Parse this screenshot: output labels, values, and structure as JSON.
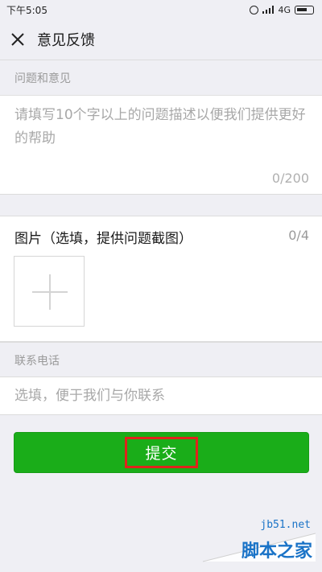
{
  "status_bar": {
    "time": "下午5:05",
    "network": "4G",
    "icons": [
      "alarm-icon",
      "signal-icon",
      "battery-icon"
    ]
  },
  "header": {
    "close_icon": "close-icon",
    "title": "意见反馈"
  },
  "feedback": {
    "section_label": "问题和意见",
    "placeholder": "请填写10个字以上的问题描述以便我们提供更好的帮助",
    "char_count": "0/200"
  },
  "images": {
    "title": "图片（选填，提供问题截图）",
    "count": "0/4",
    "add_icon": "plus-icon"
  },
  "contact": {
    "section_label": "联系电话",
    "placeholder": "选填，便于我们与你联系"
  },
  "submit": {
    "label": "提交"
  },
  "colors": {
    "background": "#efeff4",
    "primary_green": "#1aad19",
    "highlight_red": "#e0231c",
    "watermark_blue": "#1a73c7"
  },
  "watermark": {
    "site": "jb51.net",
    "name": "脚本之家"
  }
}
